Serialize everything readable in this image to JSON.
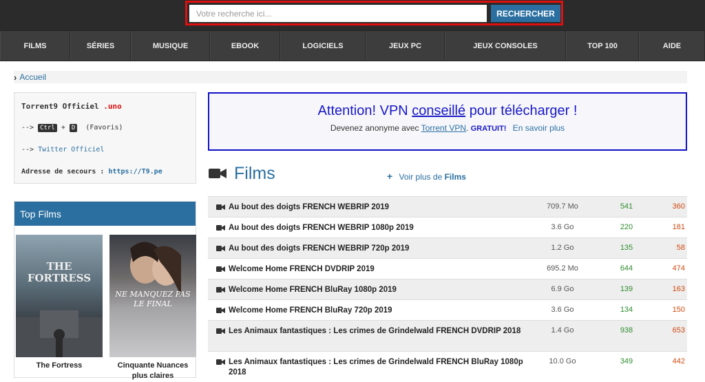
{
  "search": {
    "placeholder": "Votre recherche ici...",
    "button": "RECHERCHER"
  },
  "nav": [
    "FILMS",
    "SÉRIES",
    "MUSIQUE",
    "EBOOK",
    "LOGICIELS",
    "JEUX PC",
    "JEUX CONSOLES",
    "TOP 100",
    "AIDE"
  ],
  "breadcrumb": {
    "label": "Accueil"
  },
  "info": {
    "title": "Torrent9 Officiel",
    "tld": ".uno",
    "shortcut_prefix": "-->",
    "key1": "Ctrl",
    "plus": "+",
    "key2": "D",
    "favoris": "(Favoris)",
    "twitter_prefix": "-->",
    "twitter": "Twitter Officiel",
    "secours_label": "Adresse de secours :",
    "secours_url": "https://T9.pe"
  },
  "top_films": {
    "title": "Top Films",
    "items": [
      {
        "caption": "The Fortress",
        "poster_line1": "THE",
        "poster_line2": "FORTRESS"
      },
      {
        "caption": "Cinquante Nuances plus claires",
        "poster_line1": "NE MANQUEZ PAS",
        "poster_line2": "LE FINAL"
      }
    ]
  },
  "vpn": {
    "title_a": "Attention! VPN",
    "title_link": "conseillé",
    "title_b": "pour télécharger !",
    "sub_a": "Devenez anonyme avec",
    "sub_link": "Torrent VPN",
    "sub_bold": "GRATUIT!",
    "sub_more": "En savoir plus"
  },
  "films": {
    "title": "Films",
    "more_prefix": "Voir plus de",
    "more_bold": "Films",
    "rows": [
      {
        "name": "Au bout des doigts FRENCH WEBRIP 2019",
        "size": "709.7 Mo",
        "seeders": "541",
        "leechers": "360"
      },
      {
        "name": "Au bout des doigts FRENCH WEBRIP 1080p 2019",
        "size": "3.6 Go",
        "seeders": "220",
        "leechers": "181"
      },
      {
        "name": "Au bout des doigts FRENCH WEBRIP 720p 2019",
        "size": "1.2 Go",
        "seeders": "135",
        "leechers": "58"
      },
      {
        "name": "Welcome Home FRENCH DVDRIP 2019",
        "size": "695.2 Mo",
        "seeders": "644",
        "leechers": "474"
      },
      {
        "name": "Welcome Home FRENCH BluRay 1080p 2019",
        "size": "6.9 Go",
        "seeders": "139",
        "leechers": "163"
      },
      {
        "name": "Welcome Home FRENCH BluRay 720p 2019",
        "size": "3.6 Go",
        "seeders": "134",
        "leechers": "150"
      },
      {
        "name": "Les Animaux fantastiques : Les crimes de Grindelwald FRENCH DVDRIP 2018",
        "size": "1.4 Go",
        "seeders": "938",
        "leechers": "653"
      },
      {
        "name": "Les Animaux fantastiques : Les crimes de Grindelwald FRENCH BluRay 1080p 2018",
        "size": "10.0 Go",
        "seeders": "349",
        "leechers": "442"
      }
    ]
  },
  "colors": {
    "accent": "#2a6fa0",
    "seed": "#2e8b2e",
    "leech": "#d04a10",
    "vpn_border": "#1010c8",
    "search_border": "#e01010"
  }
}
